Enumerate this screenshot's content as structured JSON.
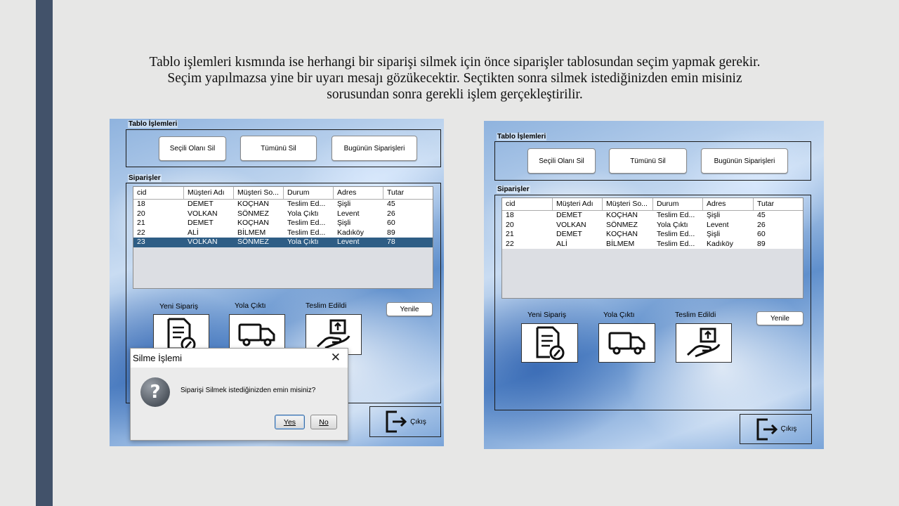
{
  "caption": {
    "line1": "Tablo işlemleri kısmında ise herhangi bir siparişi silmek için önce siparişler tablosundan seçim yapmak gerekir.",
    "line2": "Seçim yapılmazsa yine bir uyarı mesajı gözükecektir. Seçtikten sonra silmek istediğinizden emin misiniz",
    "line3": "sorusundan sonra gerekli işlem gerçekleştirilir."
  },
  "app": {
    "group_tablo": "Tablo İşlemleri",
    "group_siparisler": "Siparişler",
    "btn_secili_sil": "Seçili Olanı Sil",
    "btn_tumunu_sil": "Tümünü Sil",
    "btn_bugun": "Bugünün Siparişleri",
    "btn_yenile": "Yenile",
    "yeni_siparis": "Yeni Sipariş",
    "yola_cikti": "Yola Çıktı",
    "teslim_edildi": "Teslim Edildi",
    "cikis": "Çıkış",
    "columns": [
      "cid",
      "Müşteri Adı",
      "Müşteri So...",
      "Durum",
      "Adres",
      "Tutar"
    ]
  },
  "left_table": {
    "rows": [
      [
        "18",
        "DEMET",
        "KOÇHAN",
        "Teslim Ed...",
        "Şişli",
        "45"
      ],
      [
        "20",
        "VOLKAN",
        "SÖNMEZ",
        "Yola Çıktı",
        "Levent",
        "26"
      ],
      [
        "21",
        "DEMET",
        "KOÇHAN",
        "Teslim Ed...",
        "Şişli",
        "60"
      ],
      [
        "22",
        "ALİ",
        "BİLMEM",
        "Teslim Ed...",
        "Kadıköy",
        "89"
      ],
      [
        "23",
        "VOLKAN",
        "SÖNMEZ",
        "Yola Çıktı",
        "Levent",
        "78"
      ]
    ],
    "selected_index": 4
  },
  "right_table": {
    "rows": [
      [
        "18",
        "DEMET",
        "KOÇHAN",
        "Teslim Ed...",
        "Şişli",
        "45"
      ],
      [
        "20",
        "VOLKAN",
        "SÖNMEZ",
        "Yola Çıktı",
        "Levent",
        "26"
      ],
      [
        "21",
        "DEMET",
        "KOÇHAN",
        "Teslim Ed...",
        "Şişli",
        "60"
      ],
      [
        "22",
        "ALİ",
        "BİLMEM",
        "Teslim Ed...",
        "Kadıköy",
        "89"
      ]
    ]
  },
  "dialog": {
    "title": "Silme İşlemi",
    "message": "Siparişi Silmek istediğinizden emin misiniz?",
    "yes": "Yes",
    "no": "No",
    "icon": "question-icon"
  },
  "colors": {
    "sidebar": "#42526a",
    "selected_row": "#2e5d85"
  }
}
